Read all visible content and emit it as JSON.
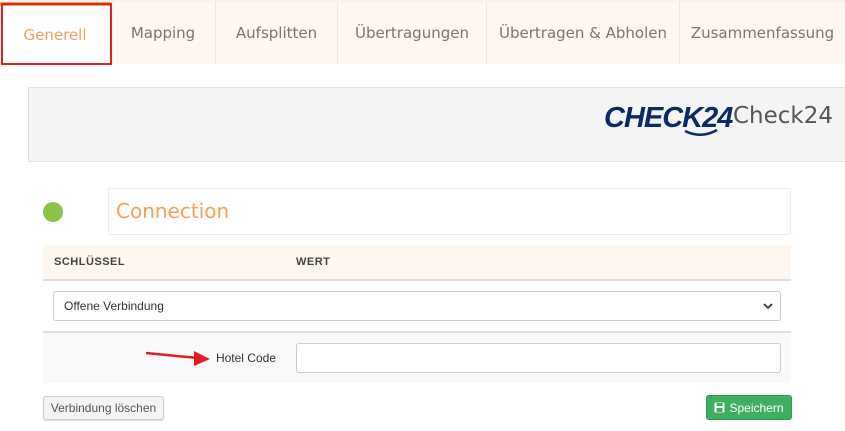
{
  "tabs": [
    {
      "label": "Generell",
      "active": true
    },
    {
      "label": "Mapping",
      "active": false
    },
    {
      "label": "Aufsplitten",
      "active": false
    },
    {
      "label": "Übertragungen",
      "active": false
    },
    {
      "label": "Übertragen & Abholen",
      "active": false
    },
    {
      "label": "Zusammenfassung",
      "active": false
    }
  ],
  "banner": {
    "logo_text": "CHECK24",
    "brand_name": "Check24"
  },
  "connection": {
    "title": "Connection",
    "status_color": "#8bc34a"
  },
  "table": {
    "headers": {
      "key": "SCHLÜSSEL",
      "value": "WERT"
    },
    "connection_type": {
      "selected": "Offene Verbindung"
    },
    "hotel_code": {
      "label": "Hotel Code",
      "value": ""
    }
  },
  "buttons": {
    "delete_label": "Verbindung löschen",
    "save_label": "Speichern"
  },
  "colors": {
    "accent": "#f0a15a",
    "highlight": "#e02020",
    "save_green": "#3fae5f",
    "logo_blue": "#0c2a66"
  },
  "icons": {
    "save": "floppy-disk-icon",
    "select": "chevron-down-icon",
    "annotation": "red-arrow-icon"
  }
}
